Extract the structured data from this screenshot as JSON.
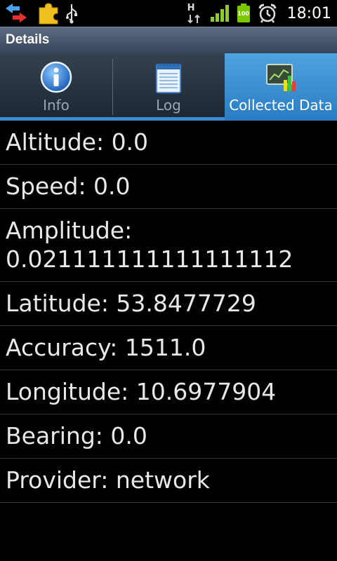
{
  "status_bar": {
    "time": "18:01",
    "battery_level": "100",
    "network_type": "H",
    "icons": [
      "transfer-arrows-icon",
      "puzzle-icon",
      "usb-icon",
      "hspa-data-icon",
      "signal-icon",
      "battery-icon",
      "alarm-icon"
    ]
  },
  "title_bar": {
    "title": "Details"
  },
  "tabs": [
    {
      "label": "Info",
      "icon": "info-icon",
      "selected": false
    },
    {
      "label": "Log",
      "icon": "notepad-icon",
      "selected": false
    },
    {
      "label": "Collected Data",
      "icon": "chart-icon",
      "selected": true
    }
  ],
  "colors": {
    "accent": "#3b8bd4",
    "selected_tab": "#2a7cc2",
    "title_bar": "#37465a",
    "background": "#000000",
    "battery_green": "#7cc800"
  },
  "rows": [
    {
      "text": "Altitude: 0.0"
    },
    {
      "text": "Speed: 0.0"
    },
    {
      "line1": "Amplitude:",
      "line2": "0.021111111111111112"
    },
    {
      "text": "Latitude: 53.8477729"
    },
    {
      "text": "Accuracy: 1511.0"
    },
    {
      "text": "Longitude: 10.6977904"
    },
    {
      "text": "Bearing: 0.0"
    },
    {
      "text": "Provider: network"
    }
  ]
}
